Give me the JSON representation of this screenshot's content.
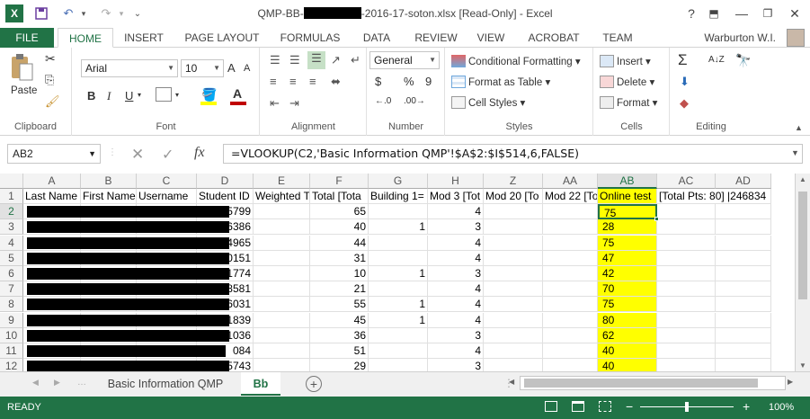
{
  "window": {
    "title_prefix": "QMP-BB-",
    "title_suffix": "-2016-17-soton.xlsx  [Read-Only] - Excel",
    "help": "?",
    "minimize": "—",
    "restore": "❐",
    "close": "✕",
    "ribbon_display": "⬒"
  },
  "qat": {
    "app": "X",
    "save": "💾",
    "undo": "↶",
    "redo": "↷",
    "customize": "⌄"
  },
  "tabs": [
    "FILE",
    "HOME",
    "INSERT",
    "PAGE LAYOUT",
    "FORMULAS",
    "DATA",
    "REVIEW",
    "VIEW",
    "ACROBAT",
    "TEAM"
  ],
  "user": "Warburton W.I.",
  "ribbon": {
    "clipboard": {
      "label": "Clipboard",
      "paste": "Paste"
    },
    "font": {
      "label": "Font",
      "name": "Arial",
      "size": "10",
      "bold": "B",
      "italic": "I",
      "underline": "U",
      "grow": "A",
      "shrink": "A"
    },
    "alignment": {
      "label": "Alignment"
    },
    "number": {
      "label": "Number",
      "format": "General",
      "currency": "$",
      "percent": "%",
      "comma": "9"
    },
    "styles": {
      "label": "Styles",
      "conditional": "Conditional Formatting",
      "format_table": "Format as Table",
      "cell_styles": "Cell Styles"
    },
    "cells": {
      "label": "Cells",
      "insert": "Insert",
      "delete": "Delete",
      "format": "Format"
    },
    "editing": {
      "label": "Editing",
      "sum": "Σ",
      "sort": "A↓Z"
    }
  },
  "formula_bar": {
    "name_box": "AB2",
    "formula": "=VLOOKUP(C2,'Basic Information QMP'!$A$2:$I$514,6,FALSE)",
    "cancel": "✕",
    "enter": "✓",
    "fx": "fx"
  },
  "columns": [
    "A",
    "B",
    "C",
    "D",
    "E",
    "F",
    "G",
    "H",
    "Z",
    "AA",
    "AB",
    "AC",
    "AD"
  ],
  "headers": [
    "Last Name",
    "First Name",
    "Username",
    "Student ID",
    "Weighted T",
    "Total [Tota",
    "Building 1=",
    "Mod 3 [Tot",
    "Mod 20 [To",
    "Mod 22 [To",
    "Online test",
    "[Total Pts: 80] |246834",
    ""
  ],
  "rows": [
    {
      "n": "2",
      "d": "5799",
      "f": "65",
      "g": "",
      "h": "4",
      "ab": "75"
    },
    {
      "n": "3",
      "d": "6386",
      "f": "40",
      "g": "1",
      "h": "3",
      "ab": "28"
    },
    {
      "n": "4",
      "d": "4965",
      "f": "44",
      "g": "",
      "h": "4",
      "ab": "75"
    },
    {
      "n": "5",
      "d": "0151",
      "f": "31",
      "g": "",
      "h": "4",
      "ab": "47"
    },
    {
      "n": "6",
      "d": "1774",
      "f": "10",
      "g": "1",
      "h": "3",
      "ab": "42"
    },
    {
      "n": "7",
      "d": "8581",
      "f": "21",
      "g": "",
      "h": "4",
      "ab": "70"
    },
    {
      "n": "8",
      "d": "6031",
      "f": "55",
      "g": "1",
      "h": "4",
      "ab": "75"
    },
    {
      "n": "9",
      "d": "1839",
      "f": "45",
      "g": "1",
      "h": "4",
      "ab": "80"
    },
    {
      "n": "10",
      "d": "1036",
      "f": "36",
      "g": "",
      "h": "3",
      "ab": "62"
    },
    {
      "n": "11",
      "d": "084",
      "f": "51",
      "g": "",
      "h": "4",
      "ab": "40"
    },
    {
      "n": "12",
      "d": "5743",
      "f": "29",
      "g": "",
      "h": "3",
      "ab": "40"
    }
  ],
  "sheets": [
    "Basic Information QMP",
    "Bb"
  ],
  "status": {
    "mode": "READY",
    "zoom": "100%"
  },
  "colors": {
    "accent": "#217346",
    "highlight": "#ffff00"
  }
}
